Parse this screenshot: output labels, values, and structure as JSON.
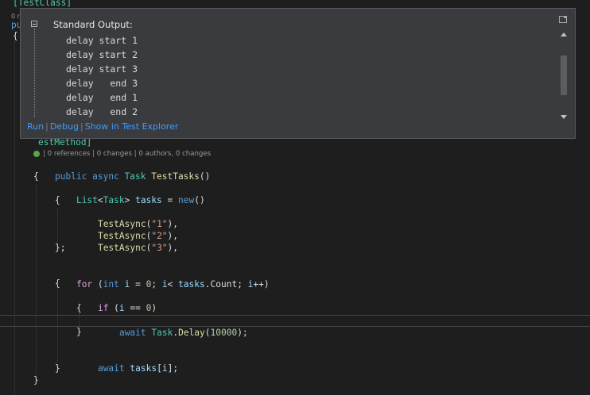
{
  "editor": {
    "top_partial": {
      "attribute": "[TestClass]",
      "refs_fragment": "0 r",
      "code_fragment": "pu",
      "brace": "{"
    },
    "method_attribute_visible": "estMethod]",
    "codelens": "| 0 references | 0 changes | 0 authors, 0 changes",
    "lines": {
      "l1": {
        "kw1": "public",
        "kw2": "async",
        "type": "Task",
        "method": "TestTasks",
        "rest": "()"
      },
      "l2": "{",
      "l3": {
        "type1": "List",
        "lt": "<",
        "type2": "Task",
        "gt": ">",
        "var": "tasks",
        "eq": " = ",
        "kw": "new",
        "rest": "()"
      },
      "l4": "{",
      "l5": {
        "method": "TestAsync",
        "open": "(",
        "str": "\"1\"",
        "close": "),"
      },
      "l6": {
        "method": "TestAsync",
        "open": "(",
        "str": "\"2\"",
        "close": "),"
      },
      "l7": {
        "method": "TestAsync",
        "open": "(",
        "str": "\"3\"",
        "close": "),"
      },
      "l8": "};",
      "l9": {
        "kw": "for",
        "p1": " (",
        "kw2": "int",
        "var1": "i",
        "p2": " = ",
        "num": "0",
        "p3": "; ",
        "var2": "i",
        "p4": "< ",
        "var3": "tasks",
        "p5": ".",
        "prop": "Count",
        "p6": "; ",
        "var4": "i",
        "p7": "++)"
      },
      "l10": "{",
      "l11": {
        "kw": "if",
        "p1": " (",
        "var": "i",
        "p2": " == ",
        "num": "0",
        "p3": ")"
      },
      "l12": "{",
      "l13": {
        "kw": "await",
        "type": "Task",
        "dot": ".",
        "method": "Delay",
        "open": "(",
        "num": "10000",
        "close": ");"
      },
      "l14": "}",
      "l15": {
        "kw": "await",
        "var": "tasks",
        "rest": "[",
        "var2": "i",
        "rest2": "];"
      },
      "l16": "}",
      "l17": "}"
    }
  },
  "popup": {
    "title": "Standard Output:",
    "output": [
      "delay start 1",
      "delay start 2",
      "delay start 3",
      "delay   end 3",
      "delay   end 1",
      "delay   end 2"
    ],
    "links": {
      "run": "Run",
      "debug": "Debug",
      "explorer": "Show in Test Explorer"
    }
  },
  "colors": {
    "background": "#1e1e1e",
    "keyword": "#569cd6",
    "control": "#d8a0df",
    "type": "#4ec9b0",
    "method": "#dcdcaa",
    "string": "#d69d85",
    "link": "#3e9bff"
  }
}
